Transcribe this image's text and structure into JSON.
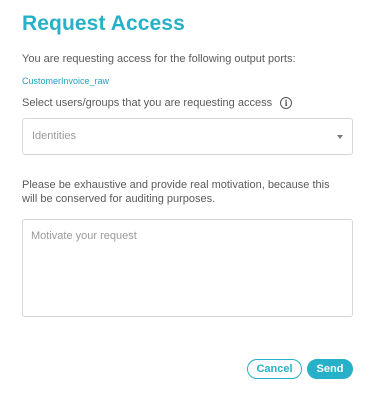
{
  "dialog": {
    "title": "Request Access",
    "intro": "You are requesting access for the following output ports:",
    "output_port": "CustomerInvoice_raw",
    "select_label": "Select users/groups that you are requesting access",
    "identities_placeholder": "Identities",
    "motivation_hint_line1": "Please be exhaustive and provide real motivation, because this",
    "motivation_hint_line2": "will be conserved for auditing purposes.",
    "motivation_placeholder": "Motivate your request",
    "cancel_label": "Cancel",
    "send_label": "Send"
  },
  "icons": {
    "info": "info-icon",
    "caret": "chevron-down-icon"
  },
  "colors": {
    "accent": "#27b1c8",
    "link": "#1aa5c4",
    "body_text": "#5a5a5a",
    "placeholder": "#9a9a9a",
    "border": "#d7d7d7"
  }
}
